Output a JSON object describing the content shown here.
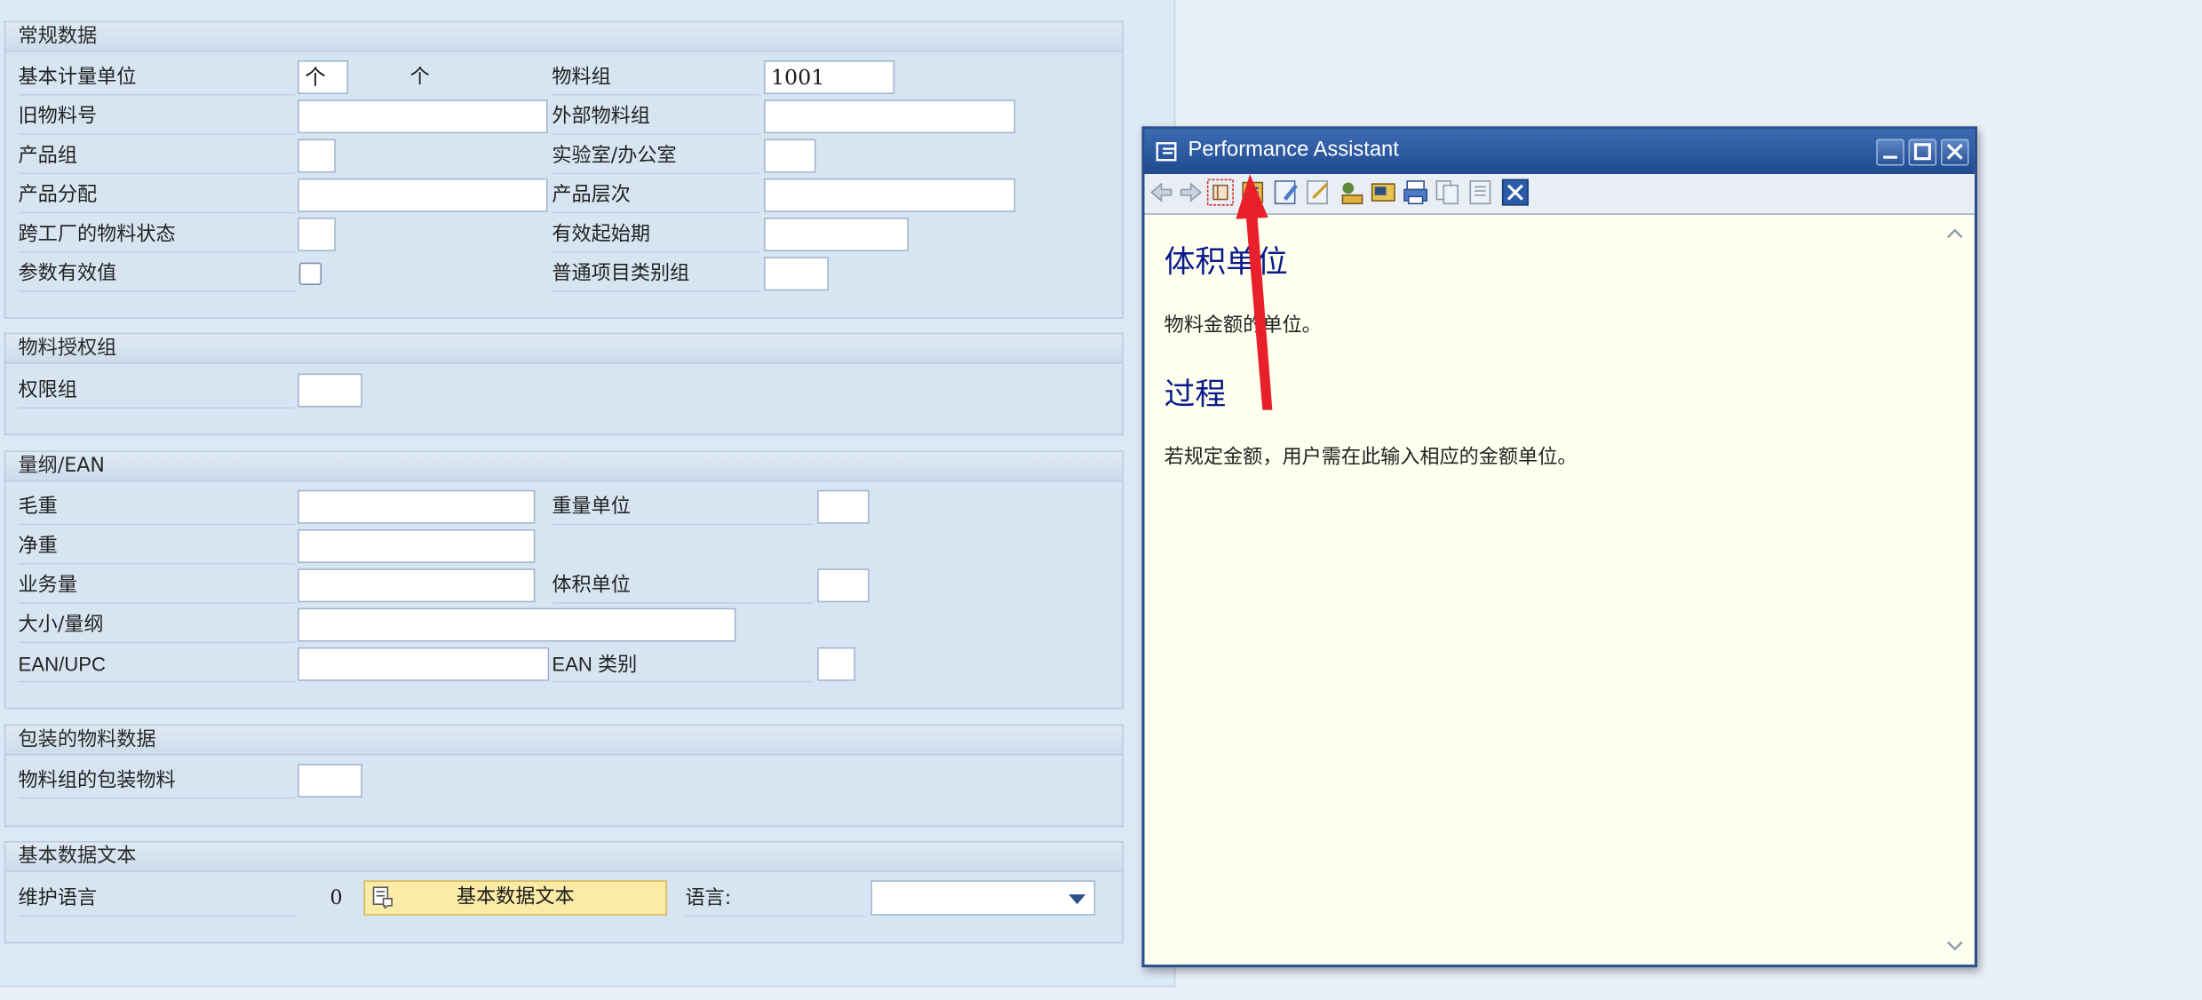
{
  "sections": {
    "general": {
      "title": "常规数据",
      "base_uom_label": "基本计量单位",
      "base_uom_value": "个",
      "base_uom_text": "个",
      "material_group_label": "物料组",
      "material_group_value": "1001",
      "old_material_label": "旧物料号",
      "ext_material_group_label": "外部物料组",
      "division_label": "产品组",
      "lab_office_label": "实验室/办公室",
      "product_allocation_label": "产品分配",
      "product_hierarchy_label": "产品层次",
      "x_plant_status_label": "跨工厂的物料状态",
      "valid_from_label": "有效起始期",
      "param_effectivity_label": "参数有效值",
      "gen_item_cat_group_label": "普通项目类别组"
    },
    "auth": {
      "title": "物料授权组",
      "auth_group_label": "权限组"
    },
    "dimensions": {
      "title": "量纲/EAN",
      "gross_weight_label": "毛重",
      "weight_unit_label": "重量单位",
      "net_weight_label": "净重",
      "volume_label": "业务量",
      "volume_unit_label": "体积单位",
      "size_dim_label": "大小/量纲",
      "ean_upc_label": "EAN/UPC",
      "ean_category_label": "EAN 类别"
    },
    "packaging": {
      "title": "包装的物料数据",
      "pack_mat_group_label": "物料组的包装物料"
    },
    "basic_text": {
      "title": "基本数据文本",
      "maint_lang_label": "维护语言",
      "maint_lang_count": "0",
      "button_label": "基本数据文本",
      "language_label": "语言:"
    }
  },
  "assistant": {
    "title": "Performance Assistant",
    "heading1": "体积单位",
    "para1": "物料金额的单位。",
    "heading2": "过程",
    "para2": "若规定金额，用户需在此输入相应的金额单位。"
  },
  "colors": {
    "annotation_arrow": "#e8202a",
    "title_bar": "#1f4a8e",
    "heading": "#0a1a8c"
  }
}
